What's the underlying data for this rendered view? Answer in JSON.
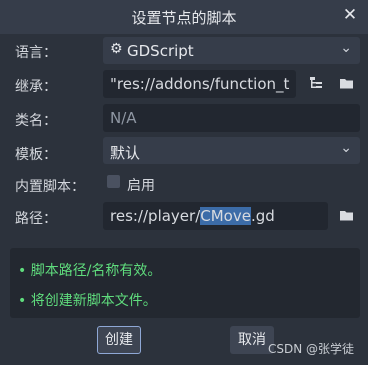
{
  "window": {
    "title": "设置节点的脚本",
    "close_glyph": "✕"
  },
  "form": {
    "language": {
      "label": "语言：",
      "value": "GDScript",
      "icon": "gear-icon"
    },
    "inherits": {
      "label": "继承：",
      "value": "\"res://addons/function_t"
    },
    "class_name": {
      "label": "类名：",
      "value": "N/A"
    },
    "template": {
      "label": "模板：",
      "value": "默认"
    },
    "builtin_script": {
      "label": "内置脚本：",
      "checkbox_label": "启用",
      "checked": false
    },
    "path": {
      "label": "路径：",
      "value_prefix": "res://player/",
      "value_selected": "CMove",
      "value_suffix": ".gd"
    }
  },
  "messages": [
    "• 脚本路径/名称有效。",
    "• 将创建新脚本文件。"
  ],
  "buttons": {
    "create": "创建",
    "cancel": "取消"
  },
  "watermark": "CSDN @张学徒",
  "colors": {
    "accent_green": "#5fdc7d",
    "selection": "#3c6ca8"
  }
}
